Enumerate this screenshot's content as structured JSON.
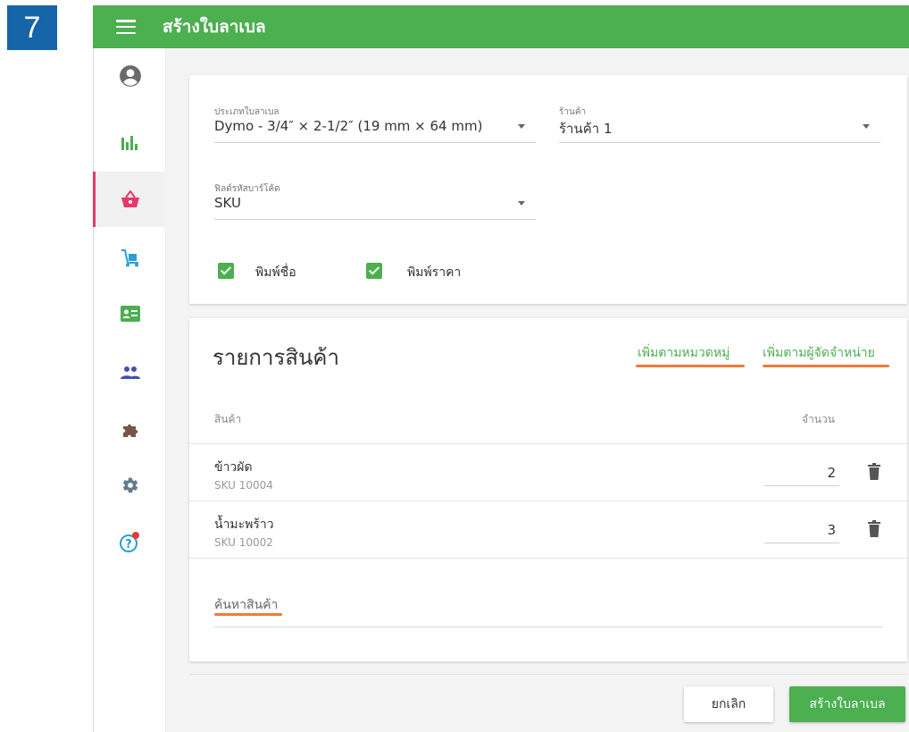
{
  "step_number": "7",
  "appbar": {
    "title": "สร้างใบลาเบล",
    "color": "#4caf50"
  },
  "sidebar": {
    "items": [
      {
        "icon": "account-circle-icon",
        "active": false
      },
      {
        "icon": "bar-chart-icon",
        "active": false
      },
      {
        "icon": "shopping-basket-icon",
        "active": true
      },
      {
        "icon": "cart-dolly-icon",
        "active": false
      },
      {
        "icon": "id-card-icon",
        "active": false
      },
      {
        "icon": "people-icon",
        "active": false
      },
      {
        "icon": "puzzle-icon",
        "active": false
      },
      {
        "icon": "settings-icon",
        "active": false
      },
      {
        "icon": "help-icon",
        "active": false
      }
    ],
    "active_color": "#e53969"
  },
  "settings": {
    "label_type": {
      "label": "ประเภทใบลาเบล",
      "value": "Dymo - 3/4″ × 2-1/2″ (19 mm × 64 mm)"
    },
    "store": {
      "label": "ร้านค้า",
      "value": "ร้านค้า 1"
    },
    "barcode_field": {
      "label": "ฟิลด์รหัสบาร์โค้ด",
      "value": "SKU"
    },
    "print_name": {
      "label": "พิมพ์ชื่อ",
      "checked": true
    },
    "print_price": {
      "label": "พิมพ์ราคา",
      "checked": true
    }
  },
  "products": {
    "title": "รายการสินค้า",
    "add_by_category": "เพิ่มตามหมวดหมู่",
    "add_by_supplier": "เพิ่มตามผู้จัดจำหน่าย",
    "columns": {
      "product": "สินค้า",
      "quantity": "จำนวน"
    },
    "rows": [
      {
        "name": "ข้าวผัด",
        "sku": "SKU 10004",
        "quantity": "2"
      },
      {
        "name": "น้ำมะพร้าว",
        "sku": "SKU 10002",
        "quantity": "3"
      }
    ],
    "search_placeholder": "ค้นหาสินค้า"
  },
  "footer": {
    "cancel_label": "ยกเลิก",
    "create_label": "สร้างใบลาเบล"
  },
  "highlight_color": "#f07a37"
}
